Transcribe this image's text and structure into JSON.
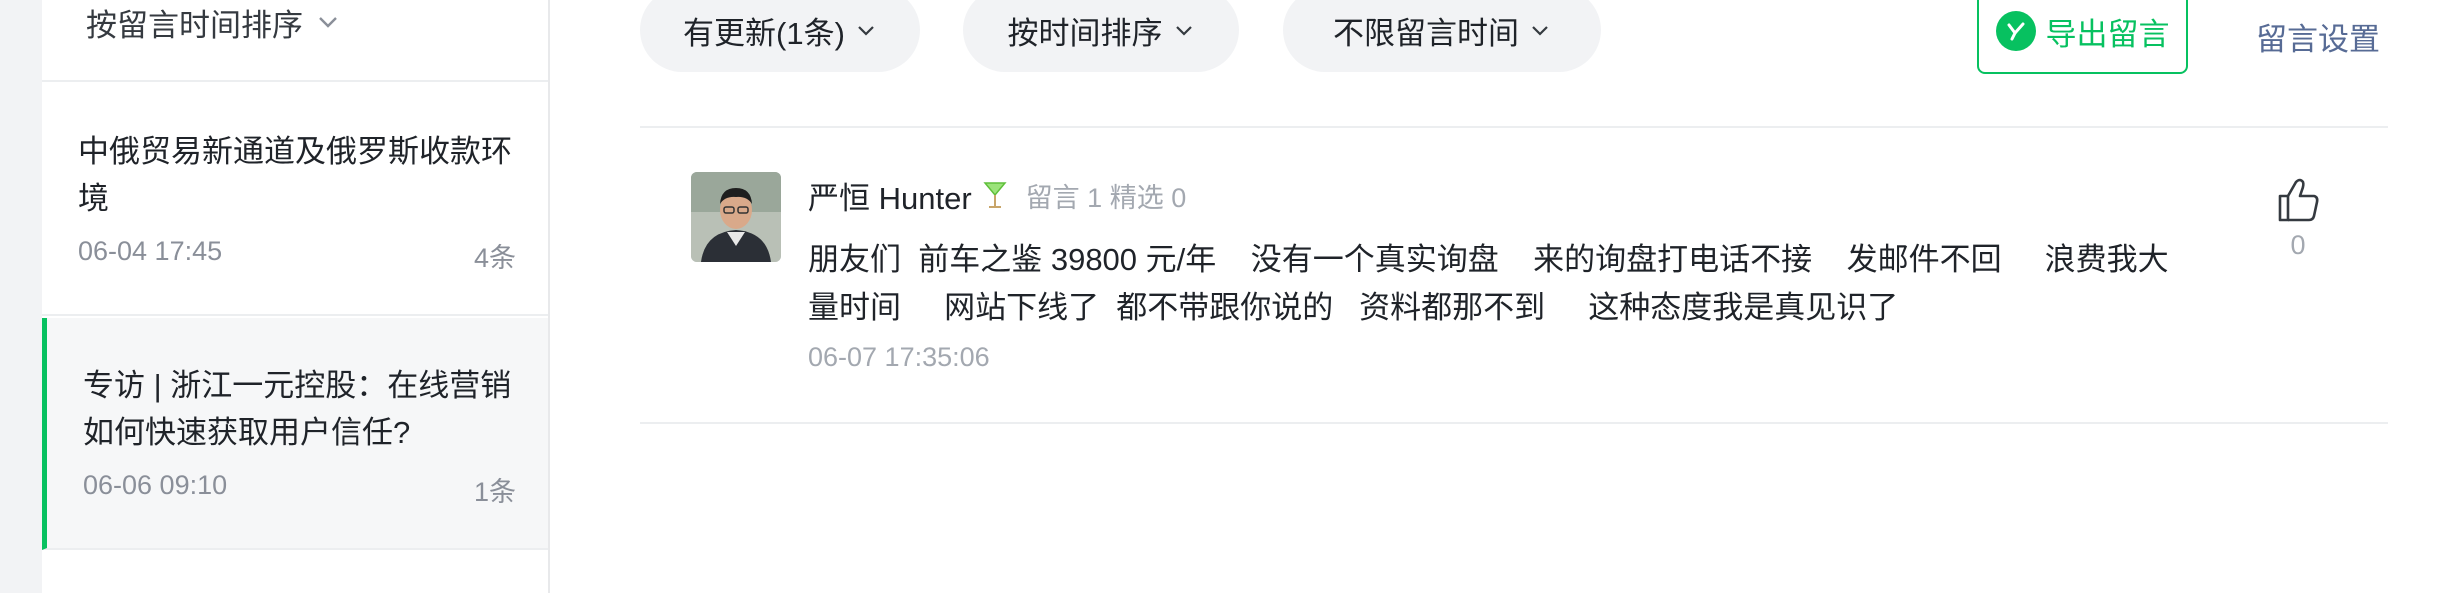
{
  "sidebar": {
    "sort_label": "按留言时间排序",
    "articles": [
      {
        "title": "中俄贸易新通道及俄罗斯收款环境",
        "date": "06-04 17:45",
        "count": "4条"
      },
      {
        "title": "专访 | 浙江一元控股：在线营销如何快速获取用户信任?",
        "date": "06-06 09:10",
        "count": "1条"
      }
    ],
    "active_index": 1
  },
  "toolbar": {
    "filter_update": "有更新(1条)",
    "filter_sort": "按时间排序",
    "filter_time": "不限留言时间",
    "export_label": "导出留言",
    "settings_label": "留言设置"
  },
  "comment": {
    "nickname": "严恒 Hunter",
    "badge_icon": "cocktail-icon",
    "stats": "留言 1 精选 0",
    "body": "朋友们  前车之鉴 39800 元/年    没有一个真实询盘    来的询盘打电话不接    发邮件不回     浪费我大量时间     网站下线了  都不带跟你说的   资料都那不到     这种态度我是真见识了",
    "time": "06-07 17:35:06",
    "like_count": "0"
  },
  "colors": {
    "accent": "#07c160",
    "link": "#576b95",
    "muted": "#a3a8b0"
  }
}
